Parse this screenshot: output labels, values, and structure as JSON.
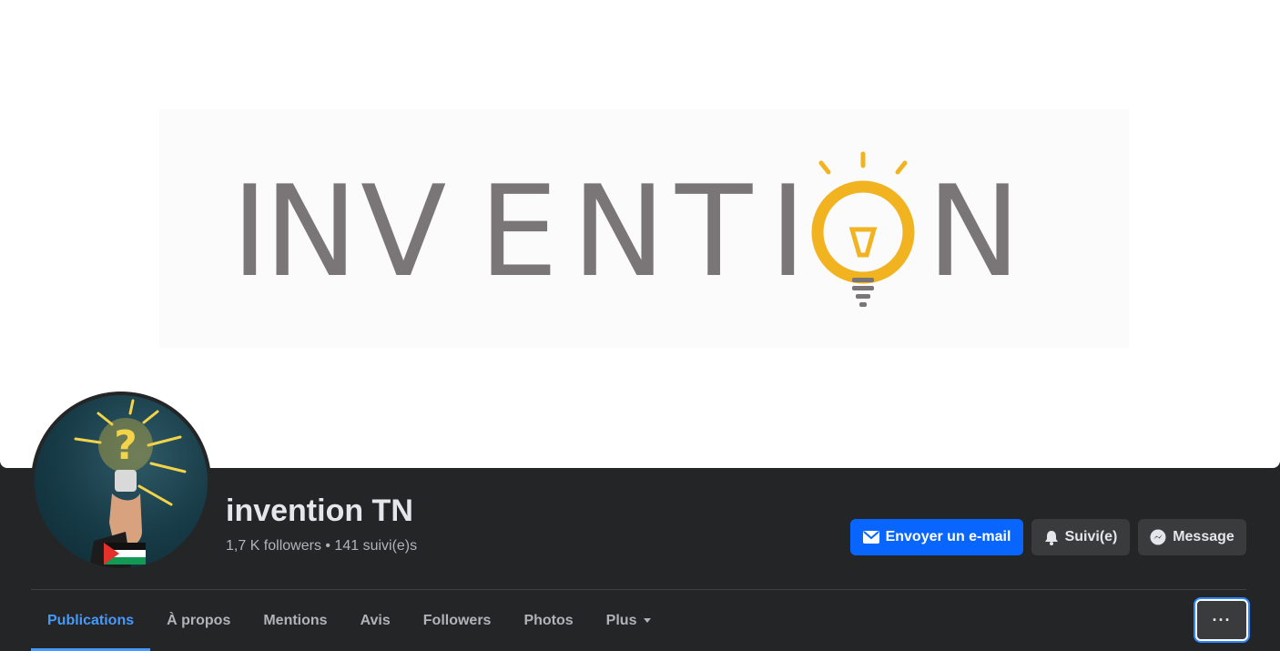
{
  "cover": {
    "logo_letters": [
      "I",
      "N",
      "V",
      "E",
      "N",
      "T",
      "I",
      "N"
    ],
    "bulb_color": "#f2b321",
    "letter_color": "#7a7576"
  },
  "profile": {
    "name": "invention TN",
    "stats": "1,7 K followers • 141 suivi(e)s"
  },
  "actions": {
    "email_label": "Envoyer un e-mail",
    "follow_label": "Suivi(e)",
    "message_label": "Message",
    "more_label": "···"
  },
  "tabs": [
    {
      "label": "Publications",
      "active": true
    },
    {
      "label": "À propos",
      "active": false
    },
    {
      "label": "Mentions",
      "active": false
    },
    {
      "label": "Avis",
      "active": false
    },
    {
      "label": "Followers",
      "active": false
    },
    {
      "label": "Photos",
      "active": false
    },
    {
      "label": "Plus",
      "active": false
    }
  ],
  "colors": {
    "accent": "#0866ff",
    "active_tab": "#4599ff",
    "background": "#242526",
    "button": "#3a3b3c"
  }
}
